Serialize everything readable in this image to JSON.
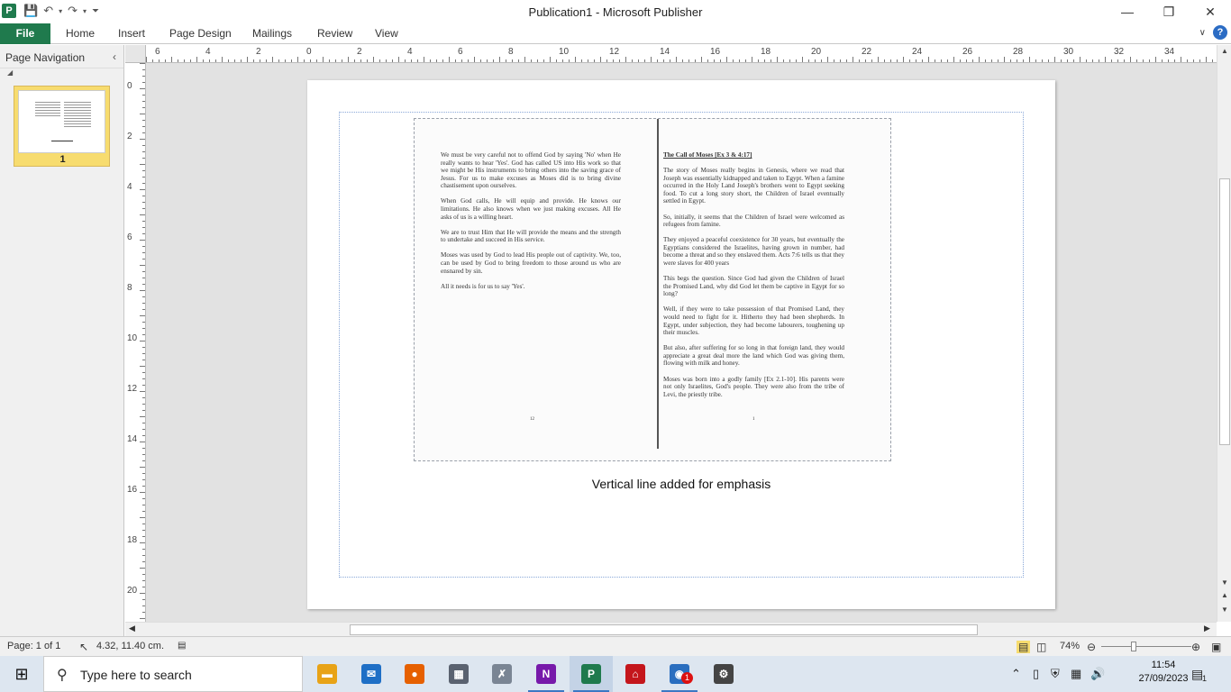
{
  "window": {
    "title": "Publication1  -  Microsoft Publisher",
    "app_icon_letter": "P",
    "minimize_glyph": "—",
    "restore_glyph": "❐",
    "close_glyph": "✕"
  },
  "quick_access": [
    "save-icon",
    "undo-icon",
    "redo-icon",
    "customize-icon"
  ],
  "ribbon": {
    "file": "File",
    "tabs": [
      "Home",
      "Insert",
      "Page Design",
      "Mailings",
      "Review",
      "View"
    ],
    "help": "?"
  },
  "nav_pane": {
    "title": "Page Navigation",
    "page_number": "1"
  },
  "ruler": {
    "horizontal": [
      "6",
      "4",
      "2",
      "0",
      "2",
      "4",
      "6",
      "8",
      "10",
      "12",
      "14",
      "16",
      "18",
      "20",
      "22",
      "24",
      "26",
      "28",
      "30",
      "32",
      "34"
    ],
    "vertical": [
      "0",
      "2",
      "4",
      "6",
      "8",
      "10",
      "12",
      "14",
      "16",
      "18",
      "20"
    ]
  },
  "document": {
    "left_page": [
      "We must be very careful not to offend God by saying 'No' when He really wants to hear 'Yes'. God has called US into His work so that we might be His instruments to bring others into the saving grace of Jesus. For us to make excuses as Moses did is to bring divine chastisement upon ourselves.",
      "When God calls, He will equip and provide. He knows our limitations. He also knows when we just making excuses. All He asks of us is a willing heart.",
      "We are to trust Him that He will provide the means and the strength to undertake and succeed in His service.",
      "Moses was used by God to lead His people out of captivity. We, too, can be used by God to bring freedom to those around us who are ensnared by sin.",
      "All it needs is for us to say 'Yes'."
    ],
    "right_heading": "The Call of Moses [Ex 3 & 4:17]",
    "right_page": [
      "The story of Moses really begins in Genesis, where we read that Joseph was essentially kidnapped and taken to Egypt. When a famine occurred in the Holy Land Joseph's brothers went to Egypt seeking food. To cut a long story short, the Children of Israel eventually settled in Egypt.",
      "So, initially, it seems that the Children of Israel were welcomed as refugees from famine.",
      "They enjoyed a peaceful coexistence for 30 years, but eventually the Egyptians considered the Israelites, having grown in number, had become a threat and so they enslaved them. Acts 7:6 tells us that they were slaves for 400 years",
      "This begs the question. Since God had given the Children of Israel the Promised Land, why did God let them be captive in Egypt for so long?",
      "Well, if they were to take possession of that Promised Land, they would need to fight for it. Hitherto they had been shepherds. In Egypt, under subjection, they had become labourers, toughening up their muscles.",
      "But also, after suffering for so long in that foreign land, they would appreciate a great deal more the land which God was giving them, flowing with milk and honey.",
      "Moses was born into a godly family [Ex 2.1-10]. His parents were not only Israelites, God's people. They were also from the tribe of Levi, the priestly tribe."
    ],
    "left_page_number": "12",
    "right_page_number": "1",
    "caption": "Vertical line added for emphasis"
  },
  "status": {
    "page": "Page: 1 of 1",
    "position": "4.32, 11.40 cm.",
    "zoom": "74%"
  },
  "taskbar": {
    "search_placeholder": "Type here to search",
    "apps": [
      {
        "name": "file-explorer-icon",
        "color": "#e8a317",
        "glyph": "▬"
      },
      {
        "name": "mail-icon",
        "color": "#1e6fc6",
        "glyph": "✉"
      },
      {
        "name": "firefox-icon",
        "color": "#e66000",
        "glyph": "●"
      },
      {
        "name": "calculator-icon",
        "color": "#5a6270",
        "glyph": "▦"
      },
      {
        "name": "language-app-icon",
        "color": "#7a8594",
        "glyph": "✗"
      },
      {
        "name": "onenote-icon",
        "color": "#7719aa",
        "glyph": "N"
      },
      {
        "name": "publisher-icon",
        "color": "#1f7a4d",
        "glyph": "P"
      },
      {
        "name": "acrobat-icon",
        "color": "#c4161c",
        "glyph": "⌂"
      },
      {
        "name": "thunderbird-icon",
        "color": "#2a6ebf",
        "glyph": "◉"
      },
      {
        "name": "settings-icon",
        "color": "#444444",
        "glyph": "⚙"
      }
    ],
    "thunderbird_badge": "1",
    "time": "11:54",
    "date": "27/09/2023",
    "notification_count": "1"
  }
}
